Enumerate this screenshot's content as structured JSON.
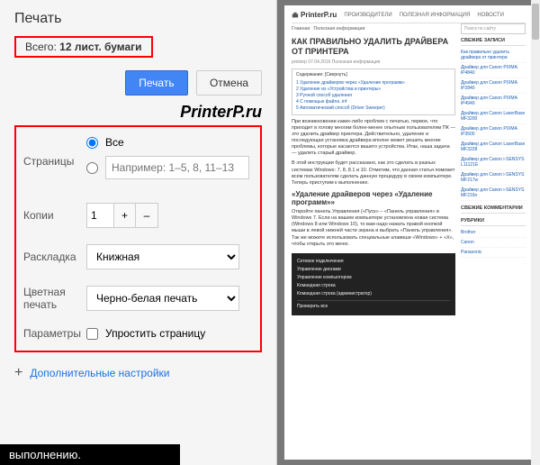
{
  "panel": {
    "title": "Печать",
    "total_prefix": "Всего: ",
    "total_value": "12 лист. бумаги",
    "print_btn": "Печать",
    "cancel_btn": "Отмена",
    "watermark": "PrinterP.ru",
    "pages_label": "Страницы",
    "pages_all": "Все",
    "pages_placeholder": "Например: 1–5, 8, 11–13",
    "copies_label": "Копии",
    "copies_value": "1",
    "layout_label": "Раскладка",
    "layout_value": "Книжная",
    "color_label": "Цветная печать",
    "color_value": "Черно-белая печать",
    "params_label": "Параметры",
    "simplify_label": "Упростить страницу",
    "more_link": "Дополнительные настройки",
    "footer": "выполнению."
  },
  "preview": {
    "logo": "PrinterP.ru",
    "nav_items": [
      "ПРОИЗВОДИТЕЛИ",
      "ПОЛЕЗНАЯ ИНФОРМАЦИЯ",
      "НОВОСТИ"
    ],
    "breadcrumb": [
      "Главная",
      "Полезная информация"
    ],
    "article_title": "КАК ПРАВИЛЬНО УДАЛИТЬ ДРАЙВЕРА ОТ ПРИНТЕРА",
    "article_meta": "printerp   07.04.2016   Полезная информация",
    "toc_title": "Содержание: [Свернуть]",
    "toc_items": [
      "1 Удаление драйверов через «Удаление программ»",
      "2 Удаление из «Устройства и принтеры»",
      "3 Ручной способ удаления",
      "4 С помощью файла .inf",
      "5 Автоматический способ (Driver Sweeper)"
    ],
    "p1": "При возникновении каких-либо проблем с печатью, первое, что приходит в голову многим более-менее опытным пользователям ПК — это удалить драйвер принтера. Действительно, удаление и последующая установка драйвера вполне может решить многие проблемы, которые касаются вашего устройства. Итак, наша задача — удалить старый драйвер.",
    "p2": "В этой инструкции будет рассказано, как это сделать в разных системах Windows: 7, 8, 8.1 и 10. Отметим, что данная статья поможет всем пользователям сделать данную процедуру в своем компьютере. Теперь приступим к выполнению.",
    "h2": "«Удаление драйверов через «Удаление программ»»",
    "p3": "Откройте панель Управления («Пуск» – «Панель управления» в Windows 7. Если на вашем компьютере установлена новая система (Windows 8 или Windows 10), то вам надо нажать правой кнопкой мыши в левой нижней части экрана и выбрать «Панель управления». Так же можете использовать специальные клавиши «Windows» + «X», чтобы открыть это меню.",
    "dark_items": [
      "Сетевое подключения",
      "Управление дисками",
      "Управление компьютером",
      "Командная строка",
      "Командная строка (администратор)"
    ],
    "dark_footer": "Проверить все",
    "search_placeholder": "Поиск по сайту",
    "side_recent_title": "СВЕЖИЕ ЗАПИСИ",
    "side_recent": [
      "Как правильно удалить драйвера от принтера",
      "Драйвер для Canon PIXMA iP4840",
      "Драйвер для Canon PIXMA iP2840",
      "Драйвер для Canon PIXMA iP4940",
      "Драйвер для Canon LaserBase MF3200",
      "Драйвер для Canon PIXMA iP3500",
      "Драйвер для Canon LaserBase MF3228",
      "Драйвер для Canon i-SENSYS L11121E",
      "Драйвер для Canon i-SENSYS MF217w",
      "Драйвер для Canon i-SENSYS MF216n"
    ],
    "side_comments_title": "СВЕЖИЕ КОММЕНТАРИИ",
    "side_rubrics_title": "РУБРИКИ",
    "side_rubrics": [
      "Brother",
      "Canon",
      "Panasonic"
    ]
  }
}
